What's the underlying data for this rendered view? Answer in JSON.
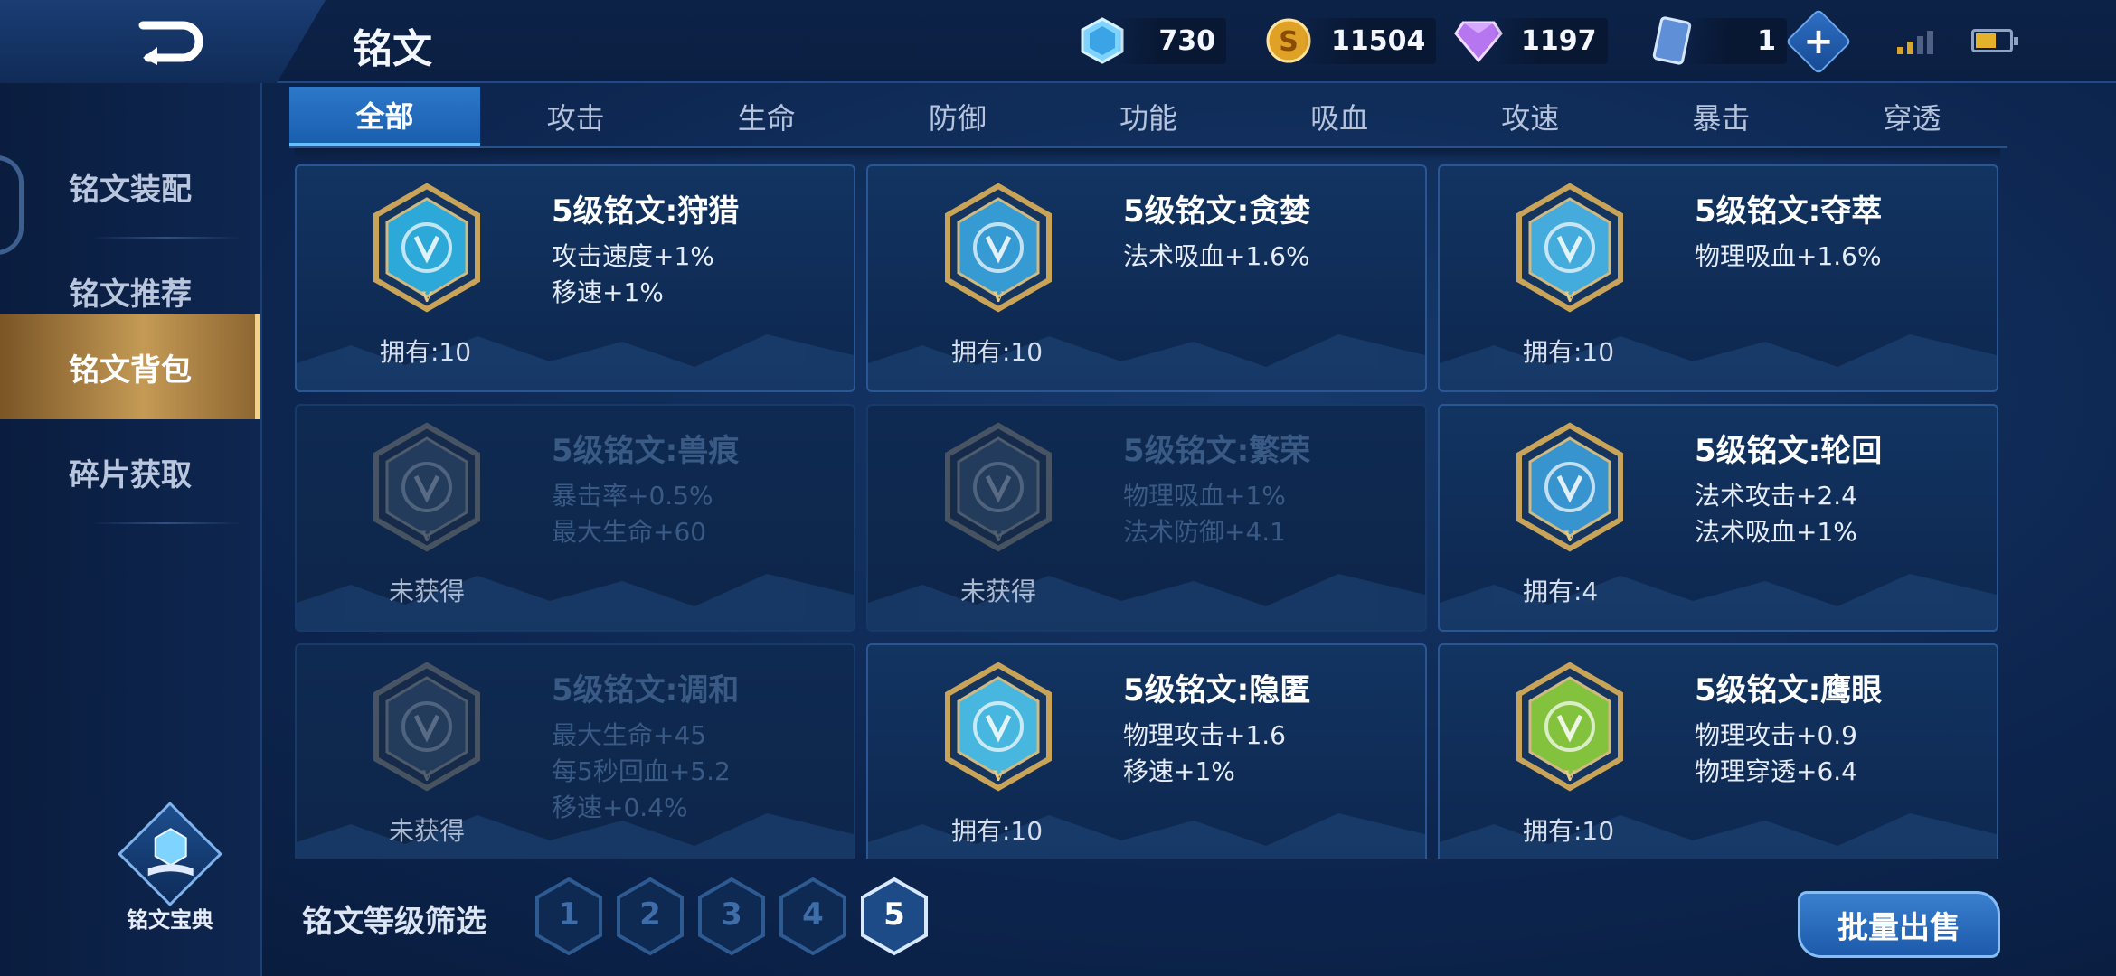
{
  "header": {
    "title": "铭文",
    "currencies": [
      {
        "icon": "crystal-icon",
        "value": "730"
      },
      {
        "icon": "gold-coin-icon",
        "value": "11504"
      },
      {
        "icon": "diamond-icon",
        "value": "1197"
      },
      {
        "icon": "card-icon",
        "value": "1"
      }
    ]
  },
  "sidebar": {
    "items": [
      {
        "label": "铭文装配"
      },
      {
        "label": "铭文推荐"
      },
      {
        "label": "铭文背包"
      },
      {
        "label": "碎片获取"
      }
    ],
    "active_index": 2,
    "codex_label": "铭文宝典"
  },
  "tabs": [
    "全部",
    "攻击",
    "生命",
    "防御",
    "功能",
    "吸血",
    "攻速",
    "暴击",
    "穿透"
  ],
  "active_tab": 0,
  "cards": [
    {
      "title": "5级铭文:狩猎",
      "stats": [
        "攻击速度+1%",
        "移速+1%"
      ],
      "own": "拥有:10",
      "locked": false,
      "color": "#2fb6e6"
    },
    {
      "title": "5级铭文:贪婪",
      "stats": [
        "法术吸血+1.6%"
      ],
      "own": "拥有:10",
      "locked": false,
      "color": "#3aa7e0"
    },
    {
      "title": "5级铭文:夺萃",
      "stats": [
        "物理吸血+1.6%"
      ],
      "own": "拥有:10",
      "locked": false,
      "color": "#4ab9ea"
    },
    {
      "title": "5级铭文:兽痕",
      "stats": [
        "暴击率+0.5%",
        "最大生命+60"
      ],
      "own": "未获得",
      "locked": true,
      "color": "#2f6ca0"
    },
    {
      "title": "5级铭文:繁荣",
      "stats": [
        "物理吸血+1%",
        "法术防御+4.1"
      ],
      "own": "未获得",
      "locked": true,
      "color": "#2f6ca0"
    },
    {
      "title": "5级铭文:轮回",
      "stats": [
        "法术攻击+2.4",
        "法术吸血+1%"
      ],
      "own": "拥有:4",
      "locked": false,
      "color": "#3b9fdc"
    },
    {
      "title": "5级铭文:调和",
      "stats": [
        "最大生命+45",
        "每5秒回血+5.2",
        "移速+0.4%"
      ],
      "own": "未获得",
      "locked": true,
      "color": "#2f6ca0"
    },
    {
      "title": "5级铭文:隐匿",
      "stats": [
        "物理攻击+1.6",
        "移速+1%"
      ],
      "own": "拥有:10",
      "locked": false,
      "color": "#4ec6ee"
    },
    {
      "title": "5级铭文:鹰眼",
      "stats": [
        "物理攻击+0.9",
        "物理穿透+6.4"
      ],
      "own": "拥有:10",
      "locked": false,
      "color": "#8fd23a"
    }
  ],
  "filter": {
    "label": "铭文等级筛选",
    "levels": [
      "1",
      "2",
      "3",
      "4",
      "5"
    ],
    "active_index": 4
  },
  "sell_button": "批量出售"
}
